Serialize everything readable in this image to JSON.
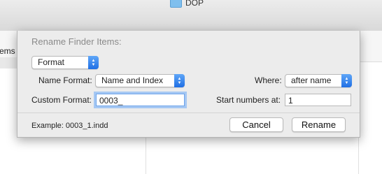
{
  "finder": {
    "window_title": "DOP",
    "left_column_text": "ems"
  },
  "sheet": {
    "title": "Rename Finder Items:",
    "mode_select": "Format",
    "name_format_label": "Name Format:",
    "name_format_value": "Name and Index",
    "where_label": "Where:",
    "where_value": "after name",
    "custom_format_label": "Custom Format:",
    "custom_format_value": "0003_",
    "start_numbers_label": "Start numbers at:",
    "start_numbers_value": "1",
    "example_text": "Example: 0003_1.indd",
    "cancel_label": "Cancel",
    "rename_label": "Rename"
  },
  "colors": {
    "accent": "#2a7ae8",
    "focus_ring": "#a6c8f3"
  }
}
